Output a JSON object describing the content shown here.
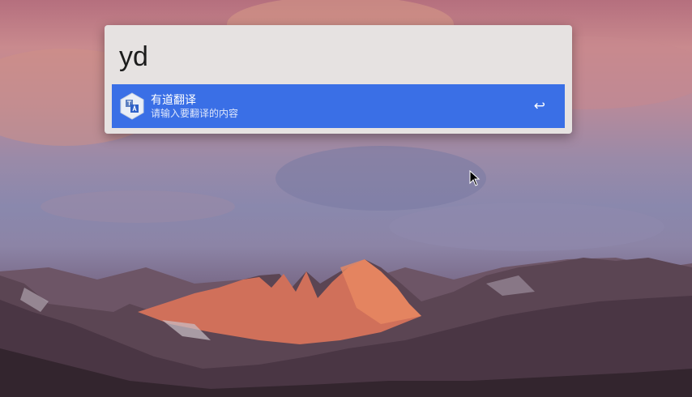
{
  "search": {
    "query": "yd"
  },
  "result": {
    "title": "有道翻译",
    "subtitle": "请输入要翻译的内容",
    "icon": "youdao-translate-icon",
    "enter_glyph": "↩"
  },
  "colors": {
    "panel_bg": "#e6e2e1",
    "selected_bg": "#3a6fe6"
  }
}
